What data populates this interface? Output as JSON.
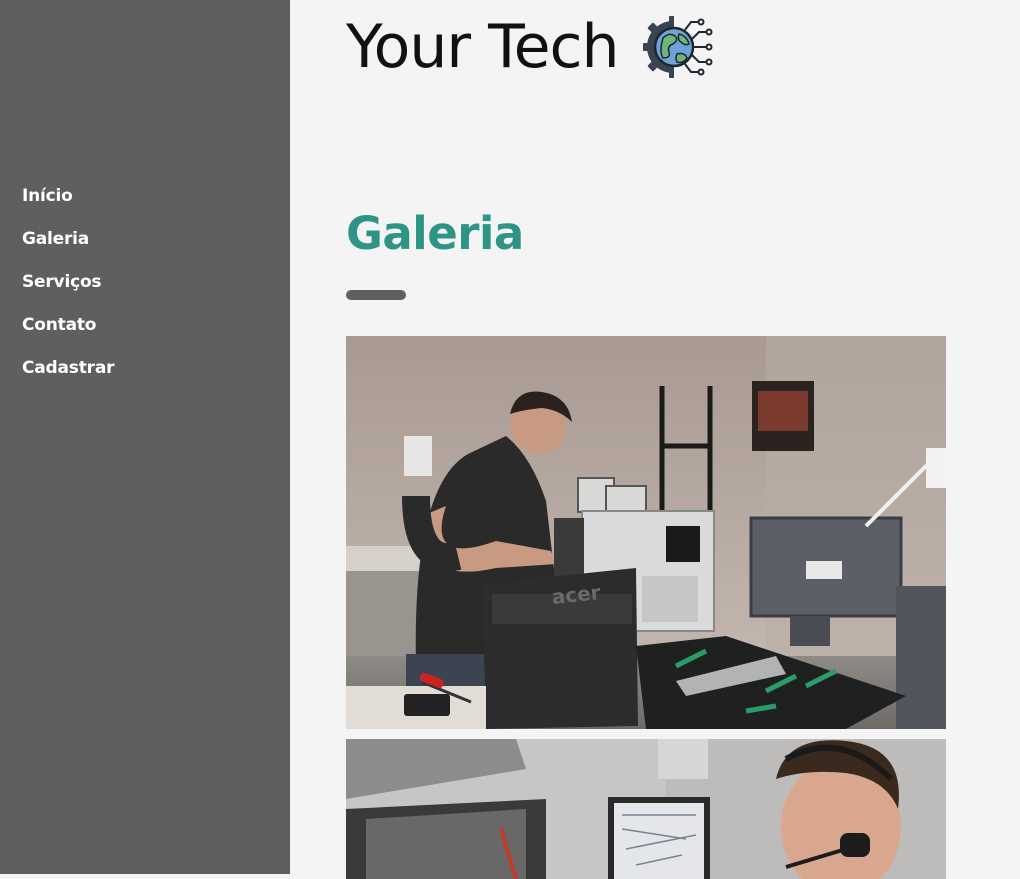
{
  "brand": {
    "name": "Your Tech",
    "logo_icon": "globe-gear-circuit-icon"
  },
  "nav": {
    "items": [
      {
        "label": "Início"
      },
      {
        "label": "Galeria"
      },
      {
        "label": "Serviços"
      },
      {
        "label": "Contato"
      },
      {
        "label": "Cadastrar"
      }
    ]
  },
  "main": {
    "title": "Galeria",
    "gallery": [
      {
        "photo_label": "acer"
      },
      {
        "photo_label": ""
      }
    ]
  },
  "colors": {
    "sidebar": "#5f5f5f",
    "background": "#f4f4f4",
    "title": "#2e9486",
    "nav_text": "#ffffff"
  }
}
